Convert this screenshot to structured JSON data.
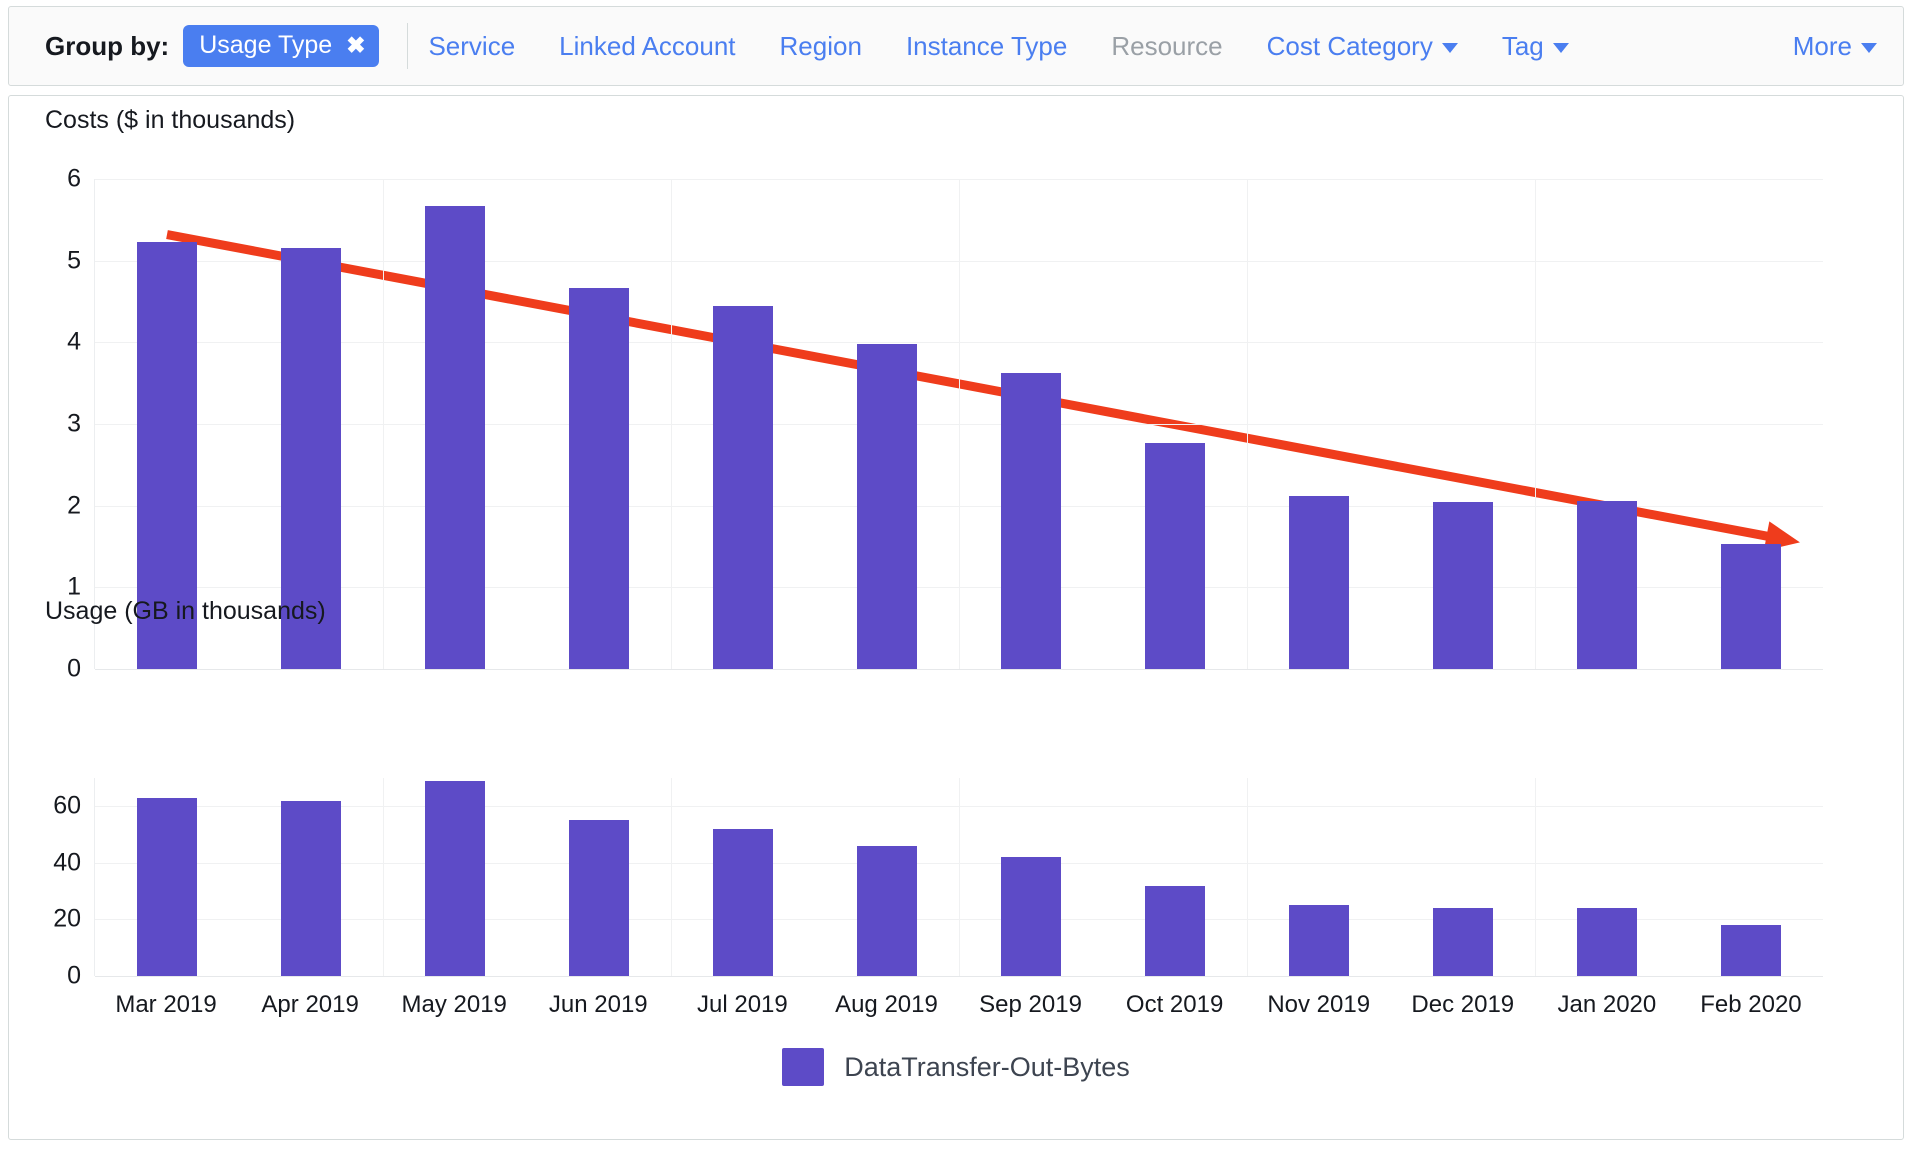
{
  "toolbar": {
    "label": "Group by:",
    "chip": {
      "text": "Usage Type",
      "remove_icon": "✖"
    },
    "links": [
      {
        "name": "service",
        "label": "Service",
        "state": "enabled",
        "caret": false
      },
      {
        "name": "linked-account",
        "label": "Linked Account",
        "state": "enabled",
        "caret": false
      },
      {
        "name": "region",
        "label": "Region",
        "state": "enabled",
        "caret": false
      },
      {
        "name": "instance-type",
        "label": "Instance Type",
        "state": "enabled",
        "caret": false
      },
      {
        "name": "resource",
        "label": "Resource",
        "state": "disabled",
        "caret": false
      },
      {
        "name": "cost-category",
        "label": "Cost Category",
        "state": "enabled",
        "caret": true
      },
      {
        "name": "tag",
        "label": "Tag",
        "state": "enabled",
        "caret": true
      }
    ],
    "more": {
      "label": "More",
      "caret": true
    }
  },
  "colors": {
    "series": "#5d4bc7",
    "trend": "#ef3c1c",
    "link": "#4a7ef0",
    "chip_bg": "#4a7ef0",
    "disabled": "#9aa0a6",
    "grid": "#f0f1f2"
  },
  "legend": {
    "items": [
      {
        "label": "DataTransfer-Out-Bytes",
        "color": "#5d4bc7"
      }
    ]
  },
  "chart_data": [
    {
      "type": "bar",
      "id": "costs",
      "title": "Costs ($ in thousands)",
      "xlabel": "",
      "ylabel": "",
      "ylim": [
        0,
        6
      ],
      "yticks": [
        0,
        1,
        2,
        3,
        4,
        5,
        6
      ],
      "grid": true,
      "legend_position": "bottom",
      "categories": [
        "Mar 2019",
        "Apr 2019",
        "May 2019",
        "Jun 2019",
        "Jul 2019",
        "Aug 2019",
        "Sep 2019",
        "Oct 2019",
        "Nov 2019",
        "Dec 2019",
        "Jan 2020",
        "Feb 2020"
      ],
      "series": [
        {
          "name": "DataTransfer-Out-Bytes",
          "values": [
            5.23,
            5.16,
            5.67,
            4.66,
            4.45,
            3.98,
            3.62,
            2.77,
            2.12,
            2.04,
            2.06,
            1.53
          ]
        }
      ],
      "annotations": [
        {
          "type": "arrow",
          "label": "downward-trend-arrow",
          "color": "#ef3c1c",
          "from": {
            "category": "Mar 2019",
            "value": 5.32
          },
          "to": {
            "category": "Feb 2020",
            "value": 1.55
          }
        }
      ]
    },
    {
      "type": "bar",
      "id": "usage",
      "title": "Usage (GB in thousands)",
      "xlabel": "",
      "ylabel": "",
      "ylim": [
        0,
        70
      ],
      "yticks": [
        0,
        20,
        40,
        60
      ],
      "grid": true,
      "legend_position": "bottom",
      "categories": [
        "Mar 2019",
        "Apr 2019",
        "May 2019",
        "Jun 2019",
        "Jul 2019",
        "Aug 2019",
        "Sep 2019",
        "Oct 2019",
        "Nov 2019",
        "Dec 2019",
        "Jan 2020",
        "Feb 2020"
      ],
      "series": [
        {
          "name": "DataTransfer-Out-Bytes",
          "values": [
            63,
            62,
            69,
            55,
            52,
            46,
            42,
            32,
            25,
            24,
            24,
            18
          ]
        }
      ]
    }
  ]
}
